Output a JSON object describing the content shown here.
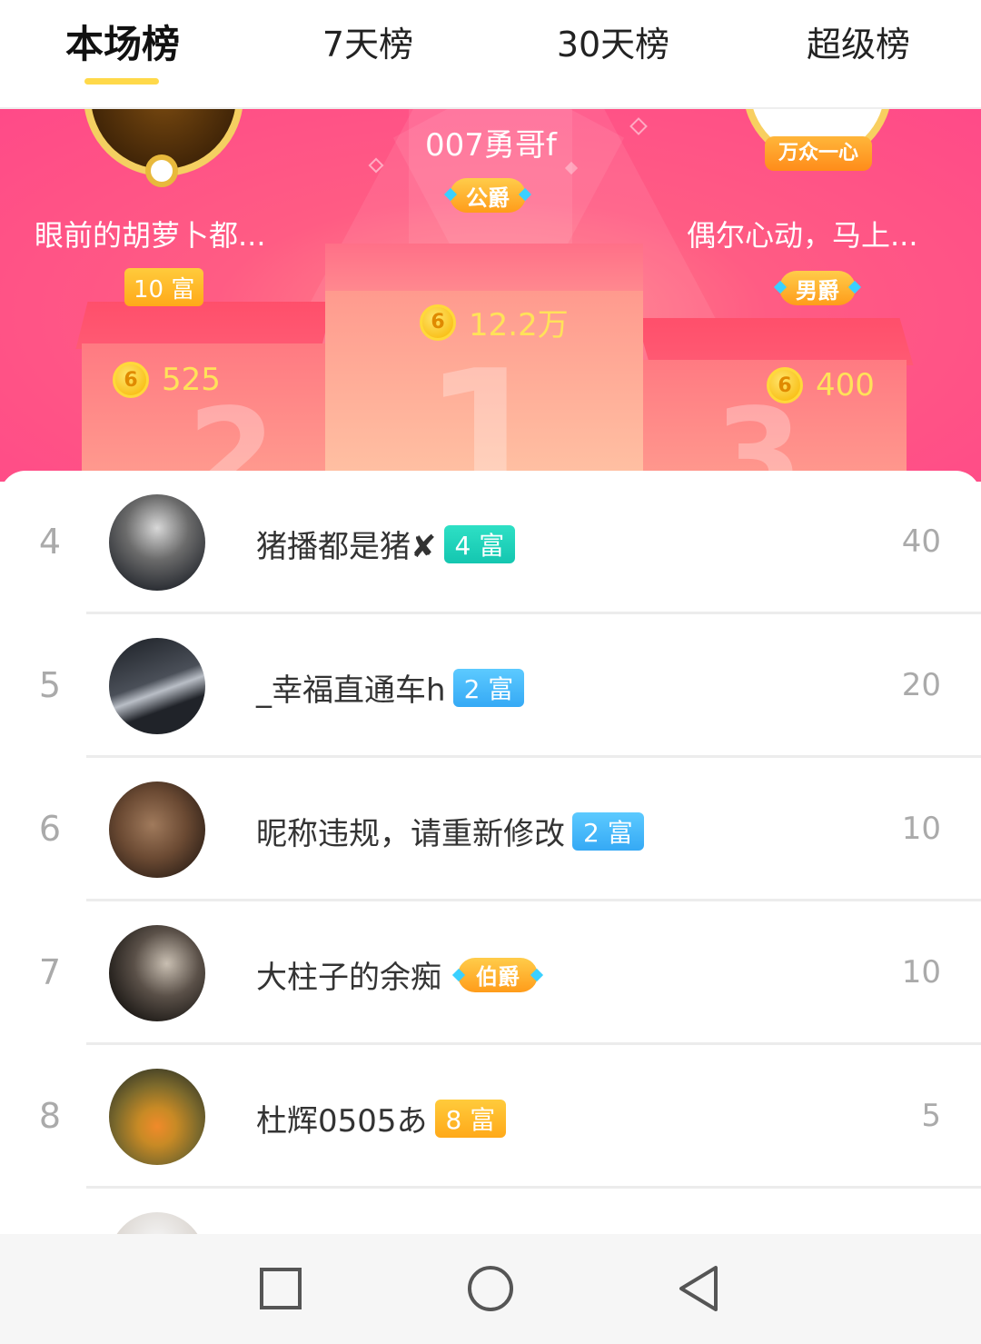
{
  "tabs": [
    {
      "label": "本场榜",
      "active": true
    },
    {
      "label": "7天榜",
      "active": false
    },
    {
      "label": "30天榜",
      "active": false
    },
    {
      "label": "超级榜",
      "active": false
    }
  ],
  "colors": {
    "accent": "#ffd94a",
    "podium_bg": "#ff4a88",
    "score_gold": "#ffe259",
    "rich_teal": "#14c6b0",
    "rich_blue": "#35a9f5",
    "rich_gold": "#ffa919"
  },
  "podium": {
    "first": {
      "rank": "1",
      "name": "007勇哥f",
      "noble": "公爵",
      "score": "12.2万",
      "coin_icon": "coin-icon"
    },
    "second": {
      "rank": "2",
      "name": "眼前的胡萝卜都...",
      "rich": "10 富",
      "score": "525",
      "coin_icon": "coin-icon"
    },
    "third": {
      "rank": "3",
      "name": "偶尔心动，马上...",
      "noble": "男爵",
      "score": "400",
      "frame_text": "万众一心",
      "coin_icon": "coin-icon"
    }
  },
  "list": [
    {
      "rank": "4",
      "name": "猪播都是猪✘",
      "badge": {
        "type": "rich",
        "color": "teal",
        "text": "4 富"
      },
      "score": "40"
    },
    {
      "rank": "5",
      "name": "_幸福直通车h",
      "badge": {
        "type": "rich",
        "color": "blue",
        "text": "2 富"
      },
      "score": "20"
    },
    {
      "rank": "6",
      "name": "昵称违规，请重新修改",
      "badge": {
        "type": "rich",
        "color": "blue",
        "text": "2 富"
      },
      "score": "10"
    },
    {
      "rank": "7",
      "name": "大柱子的余痴",
      "badge": {
        "type": "noble",
        "text": "伯爵"
      },
      "score": "10"
    },
    {
      "rank": "8",
      "name": "杜辉0505あ",
      "badge": {
        "type": "rich",
        "color": "gold",
        "text": "8 富"
      },
      "score": "5"
    }
  ],
  "navbar": {
    "recent_icon": "square-icon",
    "home_icon": "circle-icon",
    "back_icon": "triangle-back-icon"
  }
}
